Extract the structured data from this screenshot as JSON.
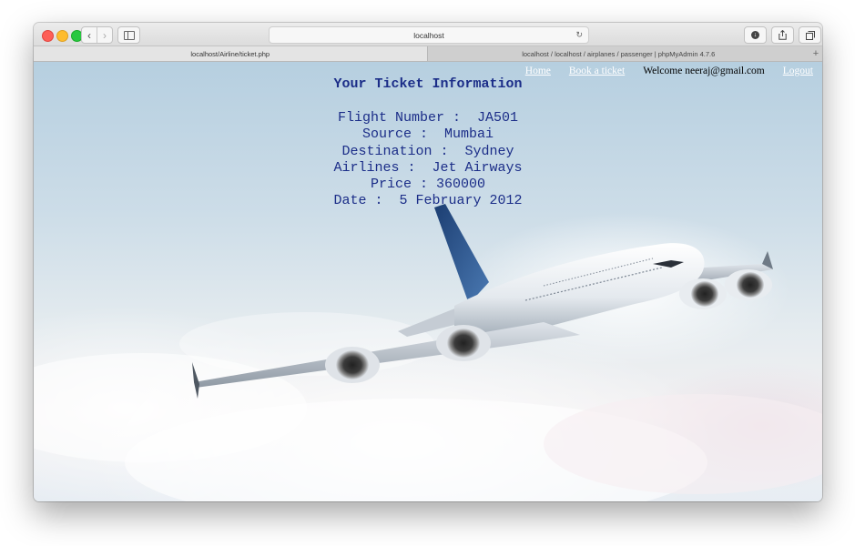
{
  "browser": {
    "url": "localhost",
    "tabs": [
      {
        "label": "localhost/Airline/ticket.php",
        "active": true
      },
      {
        "label": "localhost / localhost / airplanes / passenger | phpMyAdmin 4.7.6",
        "active": false
      }
    ],
    "icons": [
      "back-icon",
      "forward-icon",
      "sidebar-icon",
      "reload-icon",
      "download-icon",
      "share-icon",
      "tabs-icon",
      "add-tab-icon"
    ]
  },
  "nav": {
    "home": "Home",
    "book": "Book a ticket",
    "welcome": "Welcome neeraj@gmail.com",
    "logout": "Logout"
  },
  "ticket": {
    "title": "Your Ticket Information",
    "flight_label": "Flight Number :",
    "flight_value": "JA501",
    "source_label": "Source :",
    "source_value": "Mumbai",
    "destination_label": "Destination :",
    "destination_value": "Sydney",
    "airlines_label": "Airlines :",
    "airlines_value": "Jet Airways",
    "price_label": "Price :",
    "price_value": "360000",
    "date_label": "Date :",
    "date_value": "5 February 2012"
  },
  "colors": {
    "ticket_text": "#1b2d88",
    "nav_link": "#ffffff",
    "welcome_text": "#000000"
  }
}
